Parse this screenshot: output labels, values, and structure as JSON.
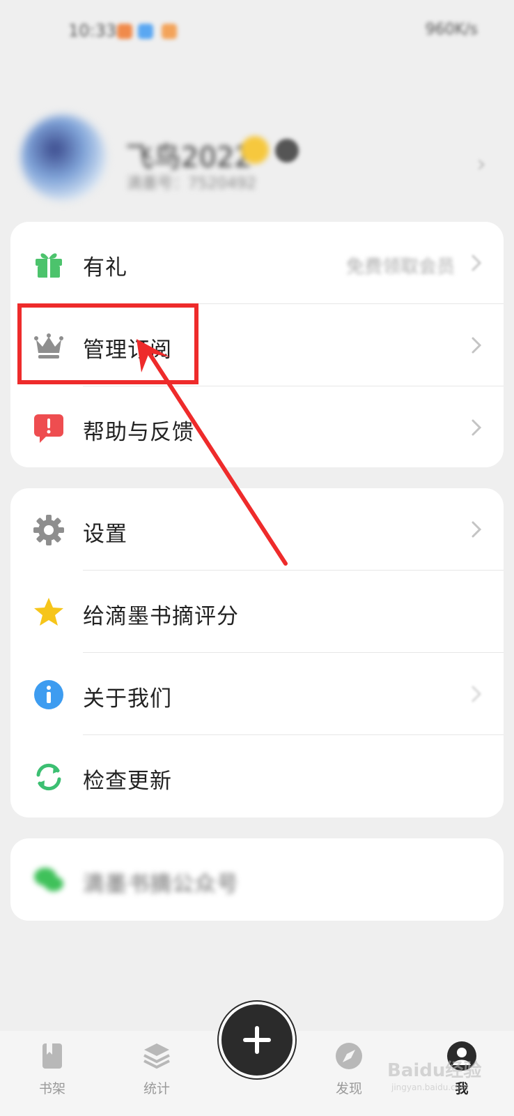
{
  "status_bar": {
    "time": "10:33",
    "right_text": "960K/s"
  },
  "profile": {
    "name": "飞鸟2022",
    "subtitle": "滴墨号：7520492"
  },
  "card1": {
    "items": [
      {
        "label": "有礼",
        "hint": "免费领取会员",
        "icon": "gift-icon",
        "icon_color": "#4cc36c"
      },
      {
        "label": "管理订阅",
        "icon": "crown-icon",
        "icon_color": "#8e8e8e"
      },
      {
        "label": "帮助与反馈",
        "icon": "feedback-icon",
        "icon_color": "#ee4d50"
      }
    ]
  },
  "card2": {
    "items": [
      {
        "label": "设置",
        "icon": "gear-icon",
        "icon_color": "#8e8e8e"
      },
      {
        "label": "给滴墨书摘评分",
        "icon": "star-icon",
        "icon_color": "#f6c51a"
      },
      {
        "label": "关于我们",
        "icon": "info-icon",
        "icon_color": "#3d9cf0"
      },
      {
        "label": "检查更新",
        "icon": "refresh-icon",
        "icon_color": "#3cbf72"
      }
    ]
  },
  "card3": {
    "label": "滴墨书摘公众号",
    "icon": "wechat-icon",
    "icon_color": "#3fc15a"
  },
  "bottom_nav": {
    "items": [
      {
        "label": "书架",
        "icon": "bookshelf-icon"
      },
      {
        "label": "统计",
        "icon": "stats-icon"
      },
      {
        "label": "发现",
        "icon": "compass-icon"
      },
      {
        "label": "我",
        "icon": "profile-icon",
        "active": true
      }
    ],
    "fab_icon": "plus-icon"
  },
  "watermark": {
    "text": "Baidu经验",
    "sub": "jingyan.baidu.com"
  },
  "colors": {
    "annotation_red": "#ee2b2b",
    "fab_background": "#2b2b2b"
  }
}
